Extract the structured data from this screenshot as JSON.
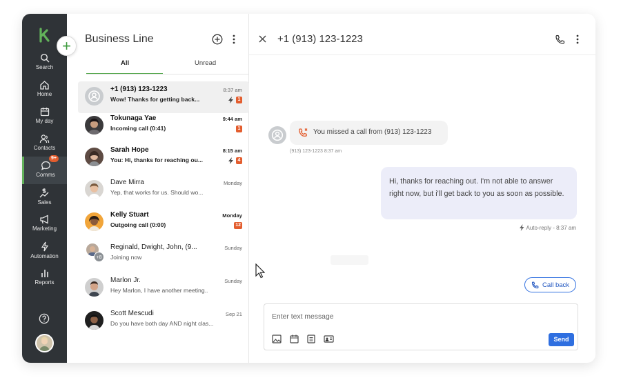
{
  "nav": {
    "items": [
      {
        "label": "Search",
        "icon": "search-icon"
      },
      {
        "label": "Home",
        "icon": "home-icon"
      },
      {
        "label": "My day",
        "icon": "calendar-icon"
      },
      {
        "label": "Contacts",
        "icon": "contacts-icon"
      },
      {
        "label": "Comms",
        "icon": "chat-icon",
        "badge": "9+"
      },
      {
        "label": "Sales",
        "icon": "dollar-chart-icon"
      },
      {
        "label": "Marketing",
        "icon": "megaphone-icon"
      },
      {
        "label": "Automation",
        "icon": "bolt-icon"
      },
      {
        "label": "Reports",
        "icon": "bar-chart-icon"
      }
    ]
  },
  "list": {
    "title": "Business Line",
    "tabs": [
      "All",
      "Unread"
    ],
    "conversations": [
      {
        "name": "+1 (913) 123-1223",
        "snippet": "Wow! Thanks for getting back...",
        "time": "8:37 am",
        "count": "1",
        "bolt": true
      },
      {
        "name": "Tokunaga Yae",
        "snippet": "Incoming call (0:41)",
        "time": "9:44 am",
        "count": "1"
      },
      {
        "name": "Sarah Hope",
        "snippet": "You: Hi, thanks for reaching ou...",
        "time": "8:15 am",
        "count": "4",
        "bolt": true
      },
      {
        "name": "Dave Mirra",
        "snippet": "Yep, that works for us. Should wo...",
        "time": "Monday"
      },
      {
        "name": "Kelly Stuart",
        "snippet": "Outgoing call (0:00)",
        "time": "Monday",
        "count": "12"
      },
      {
        "name": "Reginald, Dwight, John, (9...",
        "snippet": "Joining now",
        "time": "Sunday",
        "extra": "+8"
      },
      {
        "name": "Marlon Jr.",
        "snippet": "Hey Marlon, I have another meeting..",
        "time": "Sunday"
      },
      {
        "name": "Scott Mescudi",
        "snippet": "Do you have both day AND night clas...",
        "time": "Sep 21"
      }
    ]
  },
  "conversation": {
    "title": "+1 (913) 123-1223",
    "missed_text": "You missed a call from (913) 123-1223",
    "missed_meta": "(913) 123-1223   8:37 am",
    "reply_text": "Hi, thanks for reaching out. I'm not able to answer right now, but i'll get back to you as soon as possible.",
    "auto_reply": "Auto-reply - 8:37 am",
    "call_back": "Call back",
    "composer_placeholder": "Enter text message",
    "send": "Send"
  },
  "colors": {
    "nav_bg": "#2f3337",
    "accent_green": "#52a64a",
    "badge": "#e35d2e",
    "primary_blue": "#2f6fe0",
    "bubble": "#ecedf9"
  }
}
